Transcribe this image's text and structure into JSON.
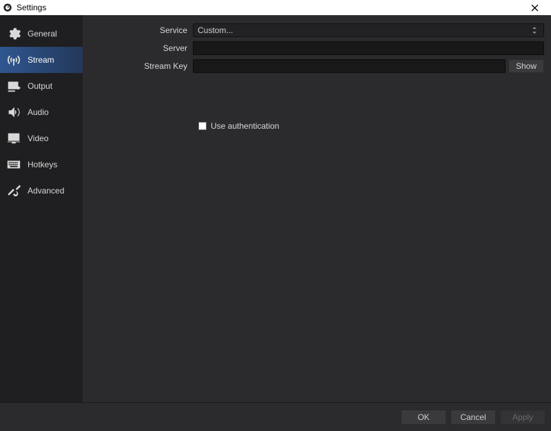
{
  "window": {
    "title": "Settings"
  },
  "sidebar": {
    "items": [
      {
        "label": "General"
      },
      {
        "label": "Stream"
      },
      {
        "label": "Output"
      },
      {
        "label": "Audio"
      },
      {
        "label": "Video"
      },
      {
        "label": "Hotkeys"
      },
      {
        "label": "Advanced"
      }
    ],
    "active_index": 1
  },
  "form": {
    "service_label": "Service",
    "service_value": "Custom...",
    "server_label": "Server",
    "server_value": "",
    "streamkey_label": "Stream Key",
    "streamkey_value": "",
    "show_button": "Show",
    "use_auth_label": "Use authentication",
    "use_auth_checked": false
  },
  "footer": {
    "ok": "OK",
    "cancel": "Cancel",
    "apply": "Apply"
  }
}
